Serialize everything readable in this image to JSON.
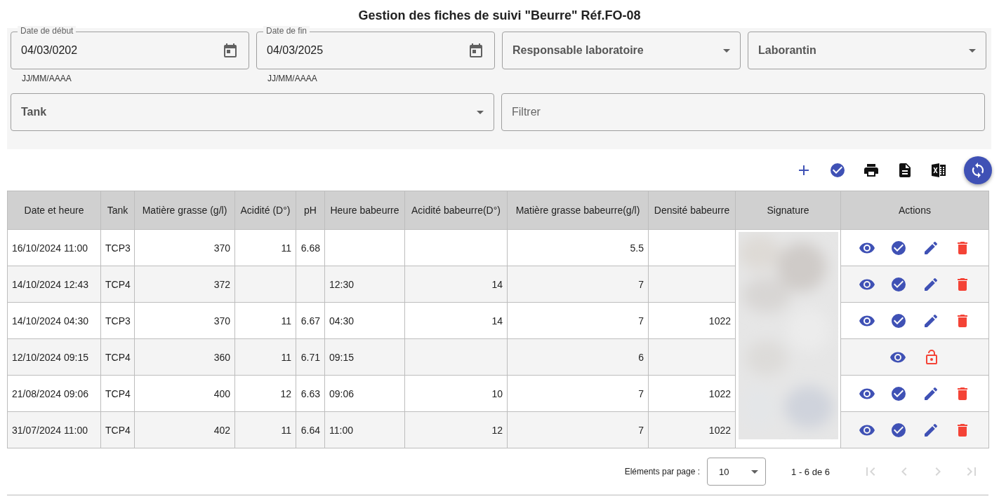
{
  "title": "Gestion des fiches de suivi \"Beurre\" Réf.FO-08",
  "filters": {
    "start_date": {
      "label": "Date de début",
      "value": "04/03/0202",
      "hint": "JJ/MM/AAAA"
    },
    "end_date": {
      "label": "Date de fin",
      "value": "04/03/2025",
      "hint": "JJ/MM/AAAA"
    },
    "selects": [
      {
        "placeholder": "Responsable laboratoire"
      },
      {
        "placeholder": "Laborantin"
      }
    ],
    "tank": {
      "placeholder": "Tank"
    },
    "search": {
      "placeholder": "Filtrer"
    }
  },
  "toolbar": [
    {
      "kind": "add"
    },
    {
      "kind": "validate"
    },
    {
      "kind": "print"
    },
    {
      "kind": "document"
    },
    {
      "kind": "excel"
    },
    {
      "kind": "refresh"
    }
  ],
  "table": {
    "columns": [
      "Date et heure",
      "Tank",
      "Matière grasse (g/l)",
      "Acidité (D°)",
      "pH",
      "Heure babeurre",
      "Acidité babeurre(D°)",
      "Matière grasse babeurre(g/l)",
      "Densité babeurre",
      "Signature",
      "Actions"
    ],
    "rows": [
      {
        "cells": [
          "16/10/2024 11:00",
          "TCP3",
          "370",
          "11",
          "6.68",
          "",
          "",
          "5.5",
          ""
        ],
        "locked": false
      },
      {
        "cells": [
          "14/10/2024 12:43",
          "TCP4",
          "372",
          "",
          "",
          "12:30",
          "14",
          "7",
          ""
        ],
        "locked": false
      },
      {
        "cells": [
          "14/10/2024 04:30",
          "TCP3",
          "370",
          "11",
          "6.67",
          "04:30",
          "14",
          "7",
          "1022"
        ],
        "locked": false
      },
      {
        "cells": [
          "12/10/2024 09:15",
          "TCP4",
          "360",
          "11",
          "6.71",
          "09:15",
          "",
          "6",
          ""
        ],
        "locked": true
      },
      {
        "cells": [
          "21/08/2024 09:06",
          "TCP4",
          "400",
          "12",
          "6.63",
          "09:06",
          "10",
          "7",
          "1022"
        ],
        "locked": false
      },
      {
        "cells": [
          "31/07/2024 11:00",
          "TCP4",
          "402",
          "11",
          "6.64",
          "11:00",
          "12",
          "7",
          "1022"
        ],
        "locked": false
      }
    ]
  },
  "paginator": {
    "label": "Eléments par page :",
    "page_size": "10",
    "range": "1 - 6 de 6",
    "buttons": [
      {
        "kind": "first",
        "disabled": true
      },
      {
        "kind": "prev",
        "disabled": true
      },
      {
        "kind": "next",
        "disabled": true
      },
      {
        "kind": "last",
        "disabled": true
      }
    ]
  }
}
